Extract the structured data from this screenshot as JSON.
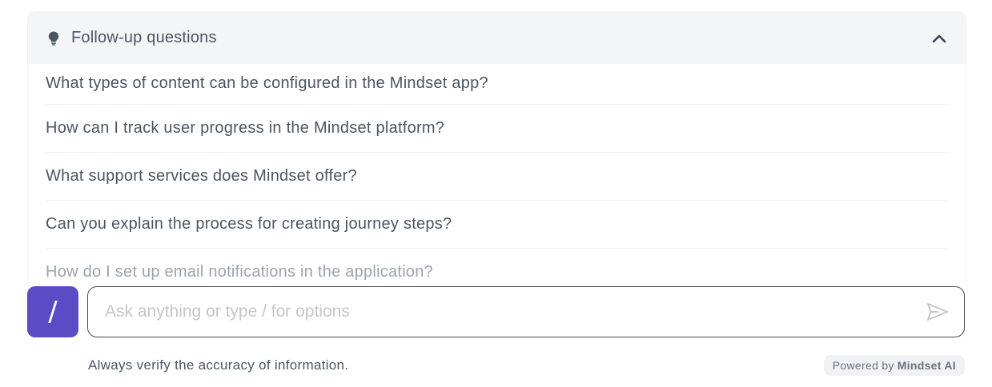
{
  "followup": {
    "title": "Follow-up questions",
    "questions": [
      "What types of content can be configured in the Mindset app?",
      "How can I track user progress in the Mindset platform?",
      "What support services does Mindset offer?",
      "Can you explain the process for creating journey steps?",
      "How do I set up email notifications in the application?"
    ]
  },
  "composer": {
    "command_label": "/",
    "placeholder": "Ask anything or type / for options"
  },
  "footer": {
    "disclaimer": "Always verify the accuracy of information.",
    "powered_prefix": "Powered by",
    "powered_brand": "Mindset AI"
  },
  "colors": {
    "accent": "#5b4bc4",
    "header_bg": "#f4f5f6",
    "text": "#4b5563"
  }
}
